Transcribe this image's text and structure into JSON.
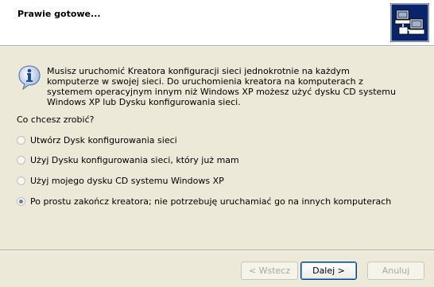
{
  "header": {
    "title": "Prawie gotowe..."
  },
  "info": {
    "text": "Musisz uruchomić Kreatora konfiguracji sieci jednokrotnie na każdym komputerze w swojej sieci. Do uruchomienia kreatora na komputerach z systemem operacyjnym innym niż Windows XP możesz użyć dysku CD systemu Windows XP lub Dysku konfigurowania sieci."
  },
  "question": "Co chcesz zrobić?",
  "options": [
    {
      "label": "Utwórz Dysk konfigurowania sieci",
      "checked": false
    },
    {
      "label": "Użyj Dysku konfigurowania sieci, który już mam",
      "checked": false
    },
    {
      "label": "Użyj mojego dysku CD systemu Windows XP",
      "checked": false
    },
    {
      "label": "Po prostu zakończ kreatora; nie potrzebuję uruchamiać go na innych komputerach",
      "checked": true
    }
  ],
  "buttons": {
    "back": "< Wstecz",
    "next": "Dalej >",
    "cancel": "Anuluj"
  }
}
